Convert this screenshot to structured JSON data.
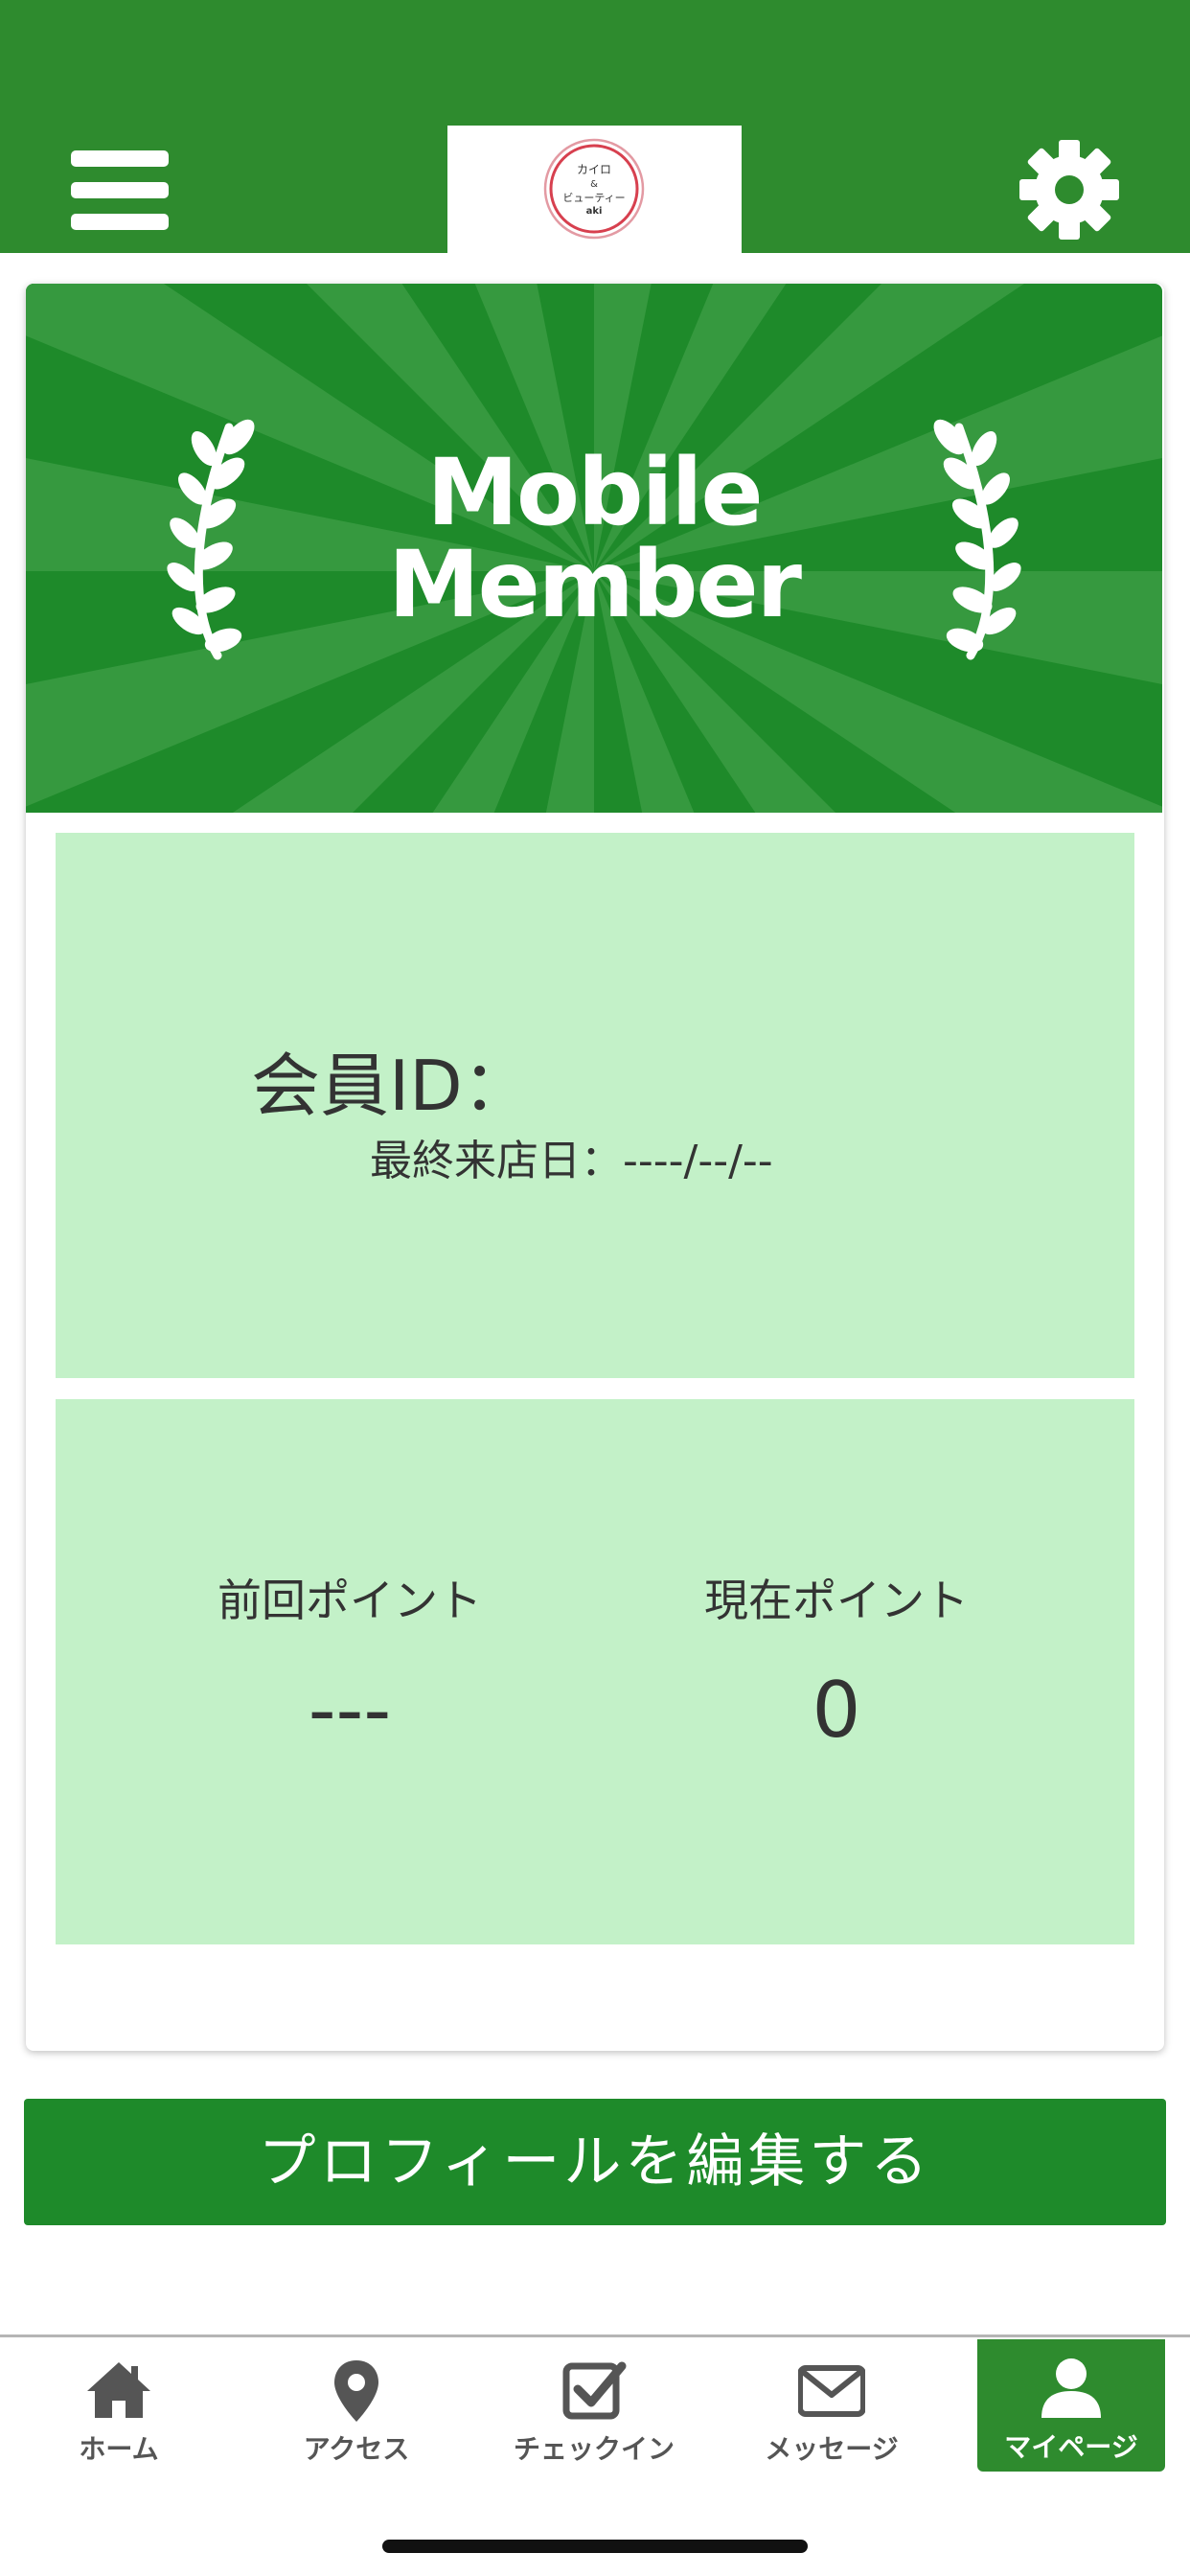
{
  "header": {
    "menu_icon": "hamburger-menu-icon",
    "settings_icon": "gear-icon",
    "logo": {
      "line1": "カイロ",
      "line2": "&",
      "line3": "ビューティー",
      "line4": "aki"
    }
  },
  "member_card": {
    "banner_title_line1": "Mobile",
    "banner_title_line2": "Member",
    "member_id_label": "会員ID：",
    "last_visit_label": "最終来店日：",
    "last_visit_value": "----/--/--",
    "previous_points_label": "前回ポイント",
    "previous_points_value": "---",
    "current_points_label": "現在ポイント",
    "current_points_value": "0"
  },
  "edit_profile_button": "プロフィールを編集する",
  "tabbar": {
    "items": [
      {
        "label": "ホーム",
        "icon": "home-icon"
      },
      {
        "label": "アクセス",
        "icon": "map-pin-icon"
      },
      {
        "label": "チェックイン",
        "icon": "checkbox-icon"
      },
      {
        "label": "メッセージ",
        "icon": "envelope-icon"
      },
      {
        "label": "マイページ",
        "icon": "user-icon",
        "active": true
      }
    ]
  },
  "colors": {
    "header_green": "#2e8b2e",
    "banner_green": "#1e8a2a",
    "panel_light_green": "#c3f1c8",
    "button_green": "#1e8a2a"
  }
}
